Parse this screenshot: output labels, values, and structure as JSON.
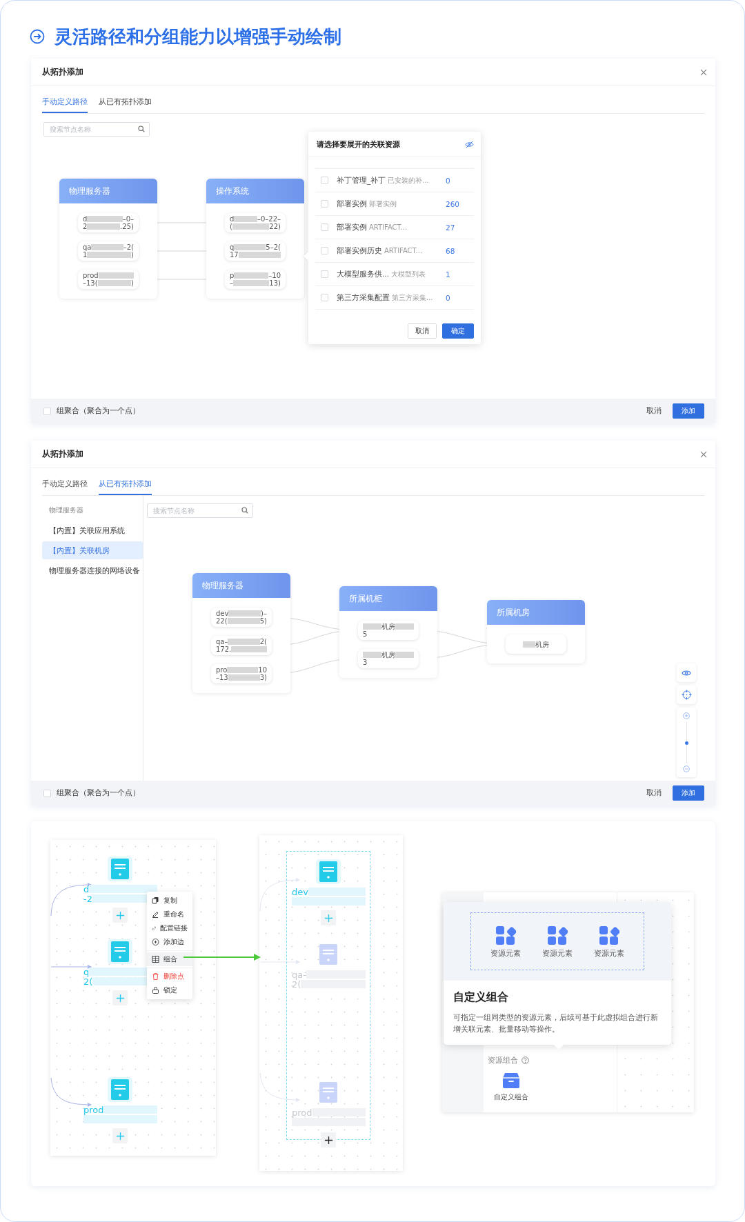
{
  "title": "灵活路径和分组能力以增强手动绘制",
  "dialogs": [
    {
      "title": "从拓扑添加",
      "tabs": [
        {
          "label": "手动定义路径",
          "selected": true
        },
        {
          "label": "从已有拓扑添加",
          "selected": false
        }
      ],
      "search": {
        "placeholder": "搜索节点名称"
      },
      "groups": [
        {
          "title": "物理服务器",
          "nodes": [
            {
              "lines": [
                [
                  {
                    "kind": "text",
                    "text": "d"
                  },
                  {
                    "kind": "redacted"
                  },
                  {
                    "kind": "text",
                    "text": "–0–"
                  }
                ],
                [
                  {
                    "kind": "text",
                    "text": "2"
                  },
                  {
                    "kind": "redacted"
                  },
                  {
                    "kind": "text",
                    "text": ".25)"
                  }
                ]
              ]
            },
            {
              "lines": [
                [
                  {
                    "kind": "text",
                    "text": "qa"
                  },
                  {
                    "kind": "redacted"
                  },
                  {
                    "kind": "text",
                    "text": "–2("
                  }
                ],
                [
                  {
                    "kind": "text",
                    "text": "1"
                  },
                  {
                    "kind": "redacted"
                  },
                  {
                    "kind": "text",
                    "text": ")"
                  }
                ]
              ]
            },
            {
              "lines": [
                [
                  {
                    "kind": "text",
                    "text": "prod"
                  },
                  {
                    "kind": "redacted"
                  }
                ],
                [
                  {
                    "kind": "text",
                    "text": "–13("
                  },
                  {
                    "kind": "redacted"
                  },
                  {
                    "kind": "text",
                    "text": ")"
                  }
                ]
              ]
            }
          ]
        },
        {
          "title": "操作系统",
          "nodes": [
            {
              "lines": [
                [
                  {
                    "kind": "text",
                    "text": "d"
                  },
                  {
                    "kind": "redacted"
                  },
                  {
                    "kind": "text",
                    "text": "–0–22–"
                  }
                ],
                [
                  {
                    "kind": "text",
                    "text": "("
                  },
                  {
                    "kind": "redacted"
                  },
                  {
                    "kind": "text",
                    "text": "22)"
                  }
                ]
              ]
            },
            {
              "lines": [
                [
                  {
                    "kind": "text",
                    "text": "q"
                  },
                  {
                    "kind": "redacted"
                  },
                  {
                    "kind": "text",
                    "text": "5–2("
                  }
                ],
                [
                  {
                    "kind": "text",
                    "text": "17"
                  },
                  {
                    "kind": "redacted"
                  }
                ]
              ]
            },
            {
              "lines": [
                [
                  {
                    "kind": "text",
                    "text": "p"
                  },
                  {
                    "kind": "redacted"
                  },
                  {
                    "kind": "text",
                    "text": "–10"
                  }
                ],
                [
                  {
                    "kind": "text",
                    "text": "–"
                  },
                  {
                    "kind": "redacted"
                  },
                  {
                    "kind": "text",
                    "text": "13)"
                  }
                ]
              ]
            }
          ]
        }
      ],
      "popup": {
        "title": "请选择要展开的关联资源",
        "rows": [
          {
            "name": "补丁管理_补丁",
            "detail": "已安装的补...",
            "count": "0",
            "checked": false
          },
          {
            "name": "部署实例",
            "detail": "部署实例",
            "count": "260",
            "checked": false
          },
          {
            "name": "部署实例",
            "detail": "ARTIFACT...",
            "count": "27",
            "checked": false
          },
          {
            "name": "部署实例历史",
            "detail": "ARTIFACT...",
            "count": "68",
            "checked": false
          },
          {
            "name": "大模型服务供...",
            "detail": "大模型列表",
            "count": "1",
            "checked": false
          },
          {
            "name": "第三方采集配置",
            "detail": "第三方采集...",
            "count": "0",
            "checked": false
          }
        ],
        "buttons": [
          "取消",
          "确定"
        ]
      },
      "footer": {
        "checkbox": {
          "label": "组聚合（聚合为一个点）",
          "checked": false
        },
        "buttons": [
          "取消",
          "添加"
        ]
      }
    },
    {
      "title": "从拓扑添加",
      "tabs": [
        {
          "label": "手动定义路径",
          "selected": false
        },
        {
          "label": "从已有拓扑添加",
          "selected": true
        }
      ],
      "sidebar": {
        "heading": "物理服务器",
        "items": [
          {
            "label": "【内置】关联应用系统",
            "selected": false
          },
          {
            "label": "【内置】关联机房",
            "selected": true
          },
          {
            "label": "物理服务器连接的网络设备",
            "selected": false
          }
        ]
      },
      "search": {
        "placeholder": "搜索节点名称"
      },
      "groups": [
        {
          "title": "物理服务器",
          "nodes": [
            {
              "lines": [
                [
                  {
                    "kind": "text",
                    "text": "dev"
                  },
                  {
                    "kind": "redacted"
                  },
                  {
                    "kind": "text",
                    "text": ")–"
                  }
                ],
                [
                  {
                    "kind": "text",
                    "text": "22("
                  },
                  {
                    "kind": "redacted"
                  },
                  {
                    "kind": "text",
                    "text": "5)"
                  }
                ]
              ]
            },
            {
              "lines": [
                [
                  {
                    "kind": "text",
                    "text": "qa–"
                  },
                  {
                    "kind": "redacted"
                  },
                  {
                    "kind": "text",
                    "text": "2("
                  }
                ],
                [
                  {
                    "kind": "text",
                    "text": "172."
                  },
                  {
                    "kind": "redacted"
                  }
                ]
              ]
            },
            {
              "lines": [
                [
                  {
                    "kind": "text",
                    "text": "pro"
                  },
                  {
                    "kind": "redacted"
                  },
                  {
                    "kind": "text",
                    "text": "10"
                  }
                ],
                [
                  {
                    "kind": "text",
                    "text": "–13"
                  },
                  {
                    "kind": "redacted"
                  },
                  {
                    "kind": "text",
                    "text": "3)"
                  }
                ]
              ]
            }
          ]
        },
        {
          "title": "所属机柜",
          "nodes": [
            {
              "lines": [
                [
                  {
                    "kind": "redacted"
                  },
                  {
                    "kind": "text",
                    "text": "机房"
                  },
                  {
                    "kind": "redacted"
                  }
                ],
                [
                  {
                    "kind": "text",
                    "text": "5"
                  }
                ]
              ]
            },
            {
              "lines": [
                [
                  {
                    "kind": "redacted"
                  },
                  {
                    "kind": "text",
                    "text": "机房"
                  },
                  {
                    "kind": "redacted"
                  }
                ],
                [
                  {
                    "kind": "text",
                    "text": "3"
                  }
                ]
              ]
            }
          ]
        },
        {
          "title": "所属机房",
          "nodes": [
            {
              "lines": [
                [
                  {
                    "kind": "redacted"
                  },
                  {
                    "kind": "text",
                    "text": "机房"
                  }
                ]
              ]
            }
          ]
        }
      ],
      "zoom": {
        "level": 0.5
      },
      "footer": {
        "checkbox": {
          "label": "组聚合（聚合为一个点）",
          "checked": false
        },
        "buttons": [
          "取消",
          "添加"
        ]
      }
    }
  ],
  "showcase": {
    "canvases": [
      {
        "grouped": false,
        "nodes": [
          {
            "faded": false,
            "lines": [
              [
                {
                  "kind": "text",
                  "text": "d"
                },
                {
                  "kind": "redacted"
                }
              ],
              [
                {
                  "kind": "text",
                  "text": "-2"
                },
                {
                  "kind": "redacted"
                }
              ]
            ]
          },
          {
            "faded": false,
            "lines": [
              [
                {
                  "kind": "text",
                  "text": "q"
                },
                {
                  "kind": "redacted"
                }
              ],
              [
                {
                  "kind": "text",
                  "text": "2("
                },
                {
                  "kind": "redacted"
                }
              ]
            ]
          },
          {
            "faded": false,
            "lines": [
              [
                {
                  "kind": "text",
                  "text": "prod"
                },
                {
                  "kind": "redacted"
                }
              ],
              [
                {
                  "kind": "redacted"
                }
              ]
            ]
          }
        ],
        "context_menu": {
          "sections": [
            [
              {
                "label": "复制",
                "kind": "normal",
                "selected": false
              },
              {
                "label": "重命名",
                "kind": "normal",
                "selected": false
              },
              {
                "label": "配置链接",
                "kind": "normal",
                "selected": false
              },
              {
                "label": "添加边",
                "kind": "normal",
                "selected": false
              }
            ],
            [
              {
                "label": "组合",
                "kind": "normal",
                "selected": true
              }
            ],
            [
              {
                "label": "删除点",
                "kind": "danger",
                "selected": false
              },
              {
                "label": "锁定",
                "kind": "normal",
                "selected": false
              }
            ]
          ]
        }
      },
      {
        "grouped": true,
        "nodes": [
          {
            "faded": false,
            "lines": [
              [
                {
                  "kind": "text",
                  "text": "dev"
                },
                {
                  "kind": "redacted"
                }
              ],
              [
                {
                  "kind": "redacted"
                }
              ]
            ]
          },
          {
            "faded": true,
            "lines": [
              [
                {
                  "kind": "text",
                  "text": "qa-"
                },
                {
                  "kind": "redacted"
                }
              ],
              [
                {
                  "kind": "text",
                  "text": "2("
                },
                {
                  "kind": "redacted"
                }
              ]
            ]
          },
          {
            "faded": true,
            "lines": [
              [
                {
                  "kind": "text",
                  "text": "prod"
                },
                {
                  "kind": "redacted"
                }
              ],
              [
                {
                  "kind": "redacted"
                }
              ]
            ]
          }
        ]
      }
    ],
    "tooltip": {
      "elements": [
        {
          "label": "资源元素"
        },
        {
          "label": "资源元素"
        },
        {
          "label": "资源元素"
        }
      ],
      "title": "自定义组合",
      "description": "可指定一组同类型的资源元素，后续可基于此虚拟组合进行新增关联元素、批量移动等操作。"
    },
    "palette": {
      "label": "资源组合",
      "items": [
        {
          "label": "自定义组合"
        }
      ]
    }
  }
}
